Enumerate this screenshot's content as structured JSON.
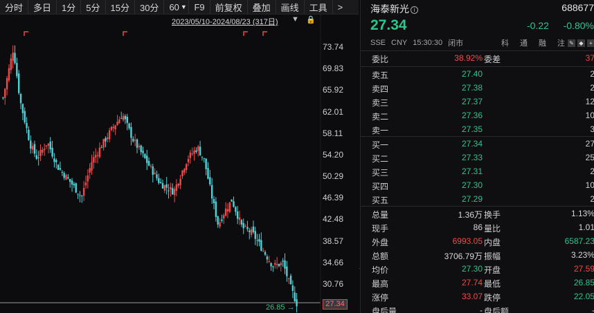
{
  "toolbar": {
    "items": [
      {
        "label": "分时"
      },
      {
        "label": "多日"
      },
      {
        "label": "1分"
      },
      {
        "label": "5分"
      },
      {
        "label": "15分"
      },
      {
        "label": "30分"
      },
      {
        "label": "60"
      },
      {
        "label": "F9"
      },
      {
        "label": "前复权"
      },
      {
        "label": "叠加"
      },
      {
        "label": "画线"
      },
      {
        "label": "工具"
      },
      {
        "label": ">"
      }
    ]
  },
  "chart": {
    "range_label": "2023/05/10-2024/08/23 (317日)",
    "current_price_tag": "27.34",
    "min_label": "26.85 →",
    "price_ticks": [
      "73.74",
      "69.83",
      "65.92",
      "62.01",
      "58.11",
      "54.20",
      "50.29",
      "46.39",
      "42.48",
      "38.57",
      "34.66",
      "30.76"
    ]
  },
  "chart_data": {
    "type": "candlestick",
    "title": "2023/05/10-2024/08/23 (317日)",
    "ylim": [
      26.85,
      73.74
    ],
    "y_ticks": [
      73.74,
      69.83,
      65.92,
      62.01,
      58.11,
      54.2,
      50.29,
      46.39,
      42.48,
      38.57,
      34.66,
      30.76
    ],
    "close_path": [
      {
        "t": 0,
        "v": 64.5
      },
      {
        "t": 2,
        "v": 70.5
      },
      {
        "t": 3,
        "v": 73.5
      },
      {
        "t": 5,
        "v": 64.0
      },
      {
        "t": 8,
        "v": 56.0
      },
      {
        "t": 10,
        "v": 53.5
      },
      {
        "t": 13,
        "v": 56.5
      },
      {
        "t": 16,
        "v": 52.0
      },
      {
        "t": 20,
        "v": 49.0
      },
      {
        "t": 23,
        "v": 46.5
      },
      {
        "t": 26,
        "v": 53.0
      },
      {
        "t": 29,
        "v": 56.0
      },
      {
        "t": 32,
        "v": 59.0
      },
      {
        "t": 35,
        "v": 61.5
      },
      {
        "t": 38,
        "v": 57.0
      },
      {
        "t": 42,
        "v": 53.0
      },
      {
        "t": 46,
        "v": 49.0
      },
      {
        "t": 50,
        "v": 47.5
      },
      {
        "t": 54,
        "v": 53.5
      },
      {
        "t": 57,
        "v": 55.5
      },
      {
        "t": 59,
        "v": 53.0
      },
      {
        "t": 61,
        "v": 47.0
      },
      {
        "t": 63,
        "v": 41.5
      },
      {
        "t": 65,
        "v": 44.0
      },
      {
        "t": 67,
        "v": 46.0
      },
      {
        "t": 70,
        "v": 41.0
      },
      {
        "t": 73,
        "v": 40.0
      },
      {
        "t": 76,
        "v": 37.0
      },
      {
        "t": 79,
        "v": 34.0
      },
      {
        "t": 82,
        "v": 34.5
      },
      {
        "t": 84,
        "v": 30.5
      },
      {
        "t": 86,
        "v": 27.2
      }
    ],
    "signal_markers": 5,
    "last": 27.34,
    "low": 26.85
  },
  "quote": {
    "name": "海泰新光",
    "code": "688677",
    "last_price": "27.34",
    "change_abs": "-0.22",
    "change_pct": "-0.80%",
    "status": [
      "SSE",
      "CNY",
      "15:30:30",
      "闭市"
    ],
    "tags": [
      "科",
      "通",
      "融",
      "注"
    ],
    "weibi": {
      "label": "委比",
      "value": "38.92%",
      "label2": "委差",
      "value2": "37"
    },
    "asks": [
      {
        "label": "卖五",
        "price": "27.40",
        "vol": "2"
      },
      {
        "label": "卖四",
        "price": "27.38",
        "vol": "2"
      },
      {
        "label": "卖三",
        "price": "27.37",
        "vol": "12"
      },
      {
        "label": "卖二",
        "price": "27.36",
        "vol": "10"
      },
      {
        "label": "卖一",
        "price": "27.35",
        "vol": "3"
      }
    ],
    "bids": [
      {
        "label": "买一",
        "price": "27.34",
        "vol": "27"
      },
      {
        "label": "买二",
        "price": "27.33",
        "vol": "25"
      },
      {
        "label": "买三",
        "price": "27.31",
        "vol": "2"
      },
      {
        "label": "买四",
        "price": "27.30",
        "vol": "10"
      },
      {
        "label": "买五",
        "price": "27.29",
        "vol": "2"
      }
    ],
    "stats": [
      {
        "l1": "总量",
        "v1": "1.36万",
        "c1": "white",
        "l2": "换手",
        "v2": "1.13%",
        "c2": "white"
      },
      {
        "l1": "现手",
        "v1": "86",
        "c1": "white",
        "l2": "量比",
        "v2": "1.01",
        "c2": "white"
      },
      {
        "l1": "外盘",
        "v1": "6993.05",
        "c1": "red",
        "l2": "内盘",
        "v2": "6587.23",
        "c2": "green"
      },
      {
        "l1": "总额",
        "v1": "3706.79万",
        "c1": "white",
        "l2": "振幅",
        "v2": "3.23%",
        "c2": "white"
      },
      {
        "l1": "均价",
        "v1": "27.30",
        "c1": "green",
        "l2": "开盘",
        "v2": "27.59",
        "c2": "red"
      },
      {
        "l1": "最高",
        "v1": "27.74",
        "c1": "red",
        "l2": "最低",
        "v2": "26.85",
        "c2": "green"
      },
      {
        "l1": "涨停",
        "v1": "33.07",
        "c1": "red",
        "l2": "跌停",
        "v2": "22.05",
        "c2": "green"
      },
      {
        "l1": "盘后量",
        "v1": "-",
        "c1": "white",
        "l2": "盘后额",
        "v2": "-",
        "c2": "white"
      }
    ]
  },
  "colors": {
    "up": "#f04a4a",
    "down": "#2fc58c",
    "candle_down": "#4fd3d9",
    "background": "#0c0c0e"
  }
}
